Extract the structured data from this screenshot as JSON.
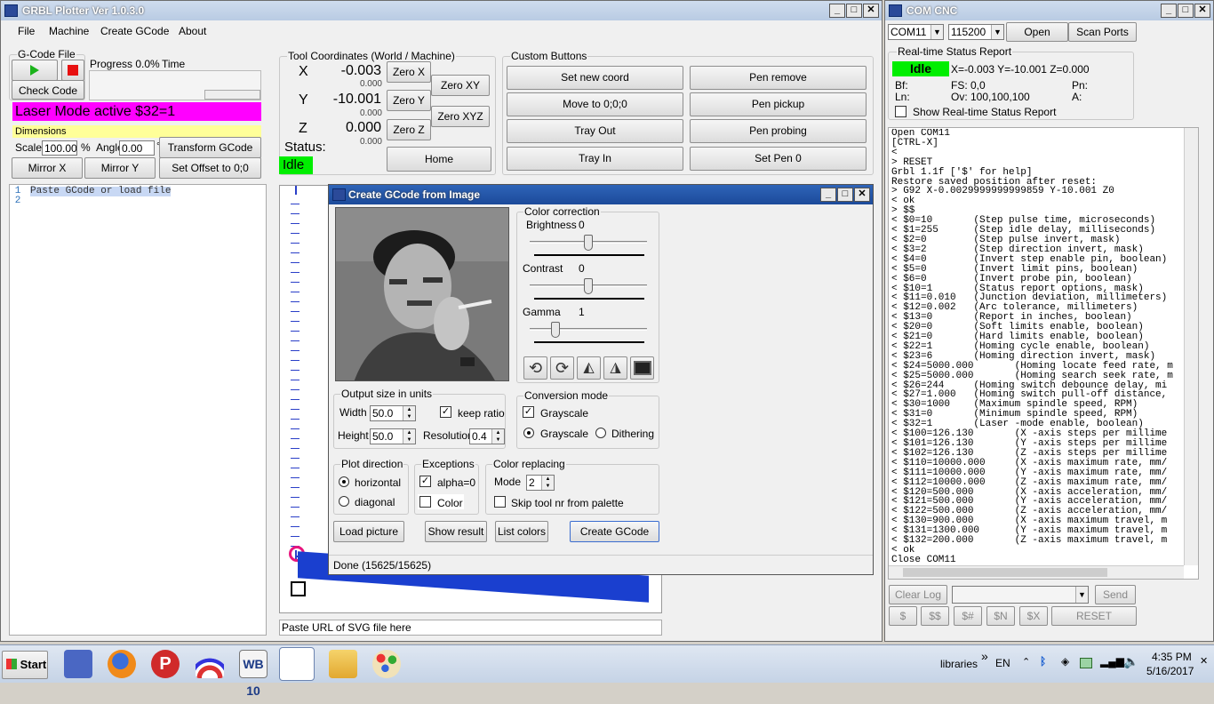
{
  "main": {
    "title": "GRBL Plotter Ver 1.0.3.0",
    "menu": [
      "File",
      "Machine",
      "Create GCode",
      "About"
    ],
    "gcode_file_label": "G-Code File",
    "progress_label": "Progress 0.0%",
    "time_label": "Time",
    "check_code": "Check Code",
    "laser_mode": "Laser Mode active $32=1",
    "dimensions_label": "Dimensions",
    "scale_label": "Scale",
    "scale_value": "100.00",
    "percent": "%",
    "angle_label": "Angle",
    "angle_value": "0.00",
    "degree": "°",
    "transform_gcode": "Transform GCode",
    "mirror_x": "Mirror X",
    "mirror_y": "Mirror Y",
    "set_offset": "Set Offset to 0;0",
    "editor_lines": [
      "1",
      "2"
    ],
    "editor_text": "Paste GCode or load file",
    "tool_coords_label": "Tool Coordinates (World / Machine)",
    "x_label": "X",
    "x_world": "-0.003",
    "x_machine": "0.000",
    "y_label": "Y",
    "y_world": "-10.001",
    "y_machine": "0.000",
    "z_label": "Z",
    "z_world": "0.000",
    "z_machine": "0.000",
    "zero_x": "Zero X",
    "zero_y": "Zero Y",
    "zero_z": "Zero Z",
    "zero_xy": "Zero XY",
    "zero_xyz": "Zero XYZ",
    "status_label": "Status:",
    "status_value": "Idle",
    "home": "Home",
    "custom_buttons_label": "Custom Buttons",
    "custom_buttons": [
      "Set new coord",
      "Pen remove",
      "Move to 0;0;0",
      "Pen pickup",
      "Tray Out",
      "Pen probing",
      "Tray In",
      "Set Pen 0"
    ],
    "svg_url_placeholder": "Paste URL of SVG file here"
  },
  "dialog": {
    "title": "Create GCode from Image",
    "color_correction_label": "Color correction",
    "brightness_label": "Brightness",
    "brightness_value": "0",
    "contrast_label": "Contrast",
    "contrast_value": "0",
    "gamma_label": "Gamma",
    "gamma_value": "1",
    "levels": {
      "brightness": 0.5,
      "contrast": 0.5,
      "gamma": 0.2
    },
    "icons": [
      "rotate-left-icon",
      "rotate-right-icon",
      "flip-vertical-icon",
      "flip-horizontal-icon",
      "image-icon"
    ],
    "output_size_label": "Output size in units",
    "width_label": "Width",
    "width_value": "50.0",
    "keep_ratio": "keep ratio",
    "height_label": "Height",
    "height_value": "50.0",
    "resolution_label": "Resolution",
    "resolution_value": "0.4",
    "conversion_mode_label": "Conversion mode",
    "grayscale_check": "Grayscale",
    "grayscale_radio": "Grayscale",
    "dithering": "Dithering",
    "plot_direction_label": "Plot direction",
    "horizontal": "horizontal",
    "diagonal": "diagonal",
    "exceptions_label": "Exceptions",
    "alpha": "alpha=0",
    "color": "Color",
    "color_replacing_label": "Color replacing",
    "mode_label": "Mode",
    "mode_value": "2",
    "skip_tool": "Skip tool nr from palette",
    "load_picture": "Load picture",
    "show_result": "Show result",
    "list_colors": "List colors",
    "create_gcode": "Create GCode",
    "status_text": "Done (15625/15625)"
  },
  "com": {
    "title": "COM CNC",
    "port": "COM11",
    "baud": "115200",
    "open": "Open",
    "scan_ports": "Scan Ports",
    "realtime_label": "Real-time Status Report",
    "state": "Idle",
    "position": "X=-0.003 Y=-10.001 Z=0.000",
    "bf": "Bf:",
    "fs": "FS:  0,0",
    "pn": "Pn:",
    "ln": "Ln:",
    "ov": "Ov:  100,100,100",
    "a": "A:",
    "show_realtime": "Show Real-time Status Report",
    "log": [
      "Open COM11",
      "[CTRL-X]",
      "<",
      "> RESET",
      "Grbl 1.1f ['$' for help]",
      "Restore saved position after reset:",
      "> G92 X-0.0029999999999859 Y-10.001 Z0",
      "< ok",
      "> $$",
      "< $0=10       (Step pulse time, microseconds)",
      "< $1=255      (Step idle delay, milliseconds)",
      "< $2=0        (Step pulse invert, mask)",
      "< $3=2        (Step direction invert, mask)",
      "< $4=0        (Invert step enable pin, boolean)",
      "< $5=0        (Invert limit pins, boolean)",
      "< $6=0        (Invert probe pin, boolean)",
      "< $10=1       (Status report options, mask)",
      "< $11=0.010   (Junction deviation, millimeters)",
      "< $12=0.002   (Arc tolerance, millimeters)",
      "< $13=0       (Report in inches, boolean)",
      "< $20=0       (Soft limits enable, boolean)",
      "< $21=0       (Hard limits enable, boolean)",
      "< $22=1       (Homing cycle enable, boolean)",
      "< $23=6       (Homing direction invert, mask)",
      "< $24=5000.000       (Homing locate feed rate, m",
      "< $25=5000.000       (Homing search seek rate, m",
      "< $26=244     (Homing switch debounce delay, mi",
      "< $27=1.000   (Homing switch pull-off distance,",
      "< $30=1000    (Maximum spindle speed, RPM)",
      "< $31=0       (Minimum spindle speed, RPM)",
      "< $32=1       (Laser -mode enable, boolean)",
      "< $100=126.130       (X -axis steps per millime",
      "< $101=126.130       (Y -axis steps per millime",
      "< $102=126.130       (Z -axis steps per millime",
      "< $110=10000.000     (X -axis maximum rate, mm/",
      "< $111=10000.000     (Y -axis maximum rate, mm/",
      "< $112=10000.000     (Z -axis maximum rate, mm/",
      "< $120=500.000       (X -axis acceleration, mm/",
      "< $121=500.000       (Y -axis acceleration, mm/",
      "< $122=500.000       (Z -axis acceleration, mm/",
      "< $130=900.000       (X -axis maximum travel, m",
      "< $131=1300.000      (Y -axis maximum travel, m",
      "< $132=200.000       (Z -axis maximum travel, m",
      "< ok",
      "Close COM11"
    ],
    "clear_log": "Clear Log",
    "send": "Send",
    "quick": [
      "$",
      "$$",
      "$#",
      "$N",
      "$X"
    ],
    "reset": "RESET"
  },
  "taskbar": {
    "start": "Start",
    "libraries": "libraries",
    "chevron": "»",
    "lang": "EN",
    "time": "4:35 PM",
    "date": "5/16/2017",
    "app_label": "WB 10"
  },
  "colors": {
    "laser": "#ff00ff",
    "idle": "#00ee00",
    "dimensions": "#ffff99",
    "blue": "#1a3fcf"
  }
}
